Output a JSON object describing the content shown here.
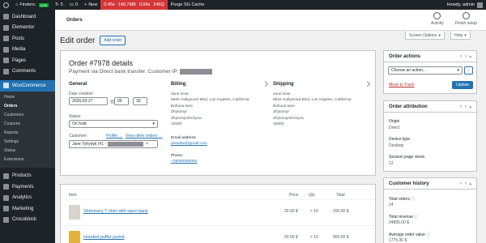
{
  "adminbar": {
    "site_name": "Findenc",
    "live_badge": "Live",
    "updates_count": "5",
    "comments_count": "0",
    "new_label": "New",
    "query_monitor": [
      "0.45s",
      "140.7MB",
      "0.06s",
      "246Q"
    ],
    "purge_label": "Purge SG Cache",
    "greeting": "Howdy, admin"
  },
  "sidebar": {
    "items_top": [
      {
        "label": "Dashboard",
        "icon": "dashboard-icon"
      },
      {
        "label": "Elementor",
        "icon": "elementor-icon"
      },
      {
        "label": "Posts",
        "icon": "pin-icon"
      },
      {
        "label": "Media",
        "icon": "media-icon"
      },
      {
        "label": "Pages",
        "icon": "pages-icon"
      },
      {
        "label": "Comments",
        "icon": "comments-icon"
      }
    ],
    "woocommerce_label": "WooCommerce",
    "submenu": [
      "Home",
      "Orders",
      "Customers",
      "Coupons",
      "Reports",
      "Settings",
      "Status",
      "Extensions"
    ],
    "items_bottom": [
      {
        "label": "Products",
        "icon": "products-icon"
      },
      {
        "label": "Payments",
        "icon": "payments-icon"
      },
      {
        "label": "Analytics",
        "icon": "analytics-icon"
      },
      {
        "label": "Marketing",
        "icon": "marketing-icon"
      },
      {
        "label": "Crocoblock",
        "icon": "crocoblock-icon"
      }
    ]
  },
  "header": {
    "title": "Orders",
    "activity_label": "Activity",
    "finish_setup_label": "Finish setup",
    "screen_options": "Screen Options",
    "help": "Help"
  },
  "page": {
    "heading": "Edit order",
    "add_order_label": "Add order"
  },
  "order": {
    "title": "Order #7978 details",
    "subtitle": "Payment via Direct bank transfer. Customer IP:",
    "general": {
      "heading": "General",
      "date_label": "Date created:",
      "date": "2026-02-27",
      "at": "@",
      "hour": "00",
      "minute": "33",
      "status_label": "Status:",
      "status": "On hold",
      "customer_label": "Customer:",
      "profile_link": "Profile →",
      "view_orders_link": "View other orders →",
      "customer_value": "Jane Tyhydyk (#1 -"
    },
    "billing": {
      "heading": "Billing",
      "address": [
        "Jane Dow",
        "6834 Hollywood Blvd, Los Angeles, California",
        "Bohuna lane",
        "Zhytomyr",
        "Zhytomyrshchyna",
        "10000"
      ],
      "email_label": "Email address:",
      "email": "janedow@gmail.com",
      "phone_label": "Phone:",
      "phone": "+38000000000"
    },
    "shipping": {
      "heading": "Shipping",
      "address": [
        "Jane Dow",
        "6834 Hollywood Blvd, Los Angeles, California",
        "Bohuna lane",
        "Zhytomyr",
        "Zhytomyrshchyna",
        "10000"
      ]
    }
  },
  "items": {
    "headers": {
      "item": "Item",
      "price": "Price",
      "qty": "Qty",
      "total": "Total"
    },
    "rows": [
      {
        "name": "Shimmery T-shirt with open back",
        "price": "20.00 $",
        "qty": "× 10",
        "total": "200.00 $"
      },
      {
        "name": "Hooded puffer jacket",
        "price": "90.00 $",
        "qty": "× 10",
        "total": "900.00 $"
      }
    ]
  },
  "order_actions": {
    "title": "Order actions",
    "select_value": "Choose an action...",
    "trash_label": "Move to Trash",
    "update_label": "Update"
  },
  "attribution": {
    "title": "Order attribution",
    "origin_label": "Origin",
    "origin": "Direct",
    "device_label": "Device type",
    "device": "Desktop",
    "views_label": "Session page views",
    "views": "12"
  },
  "customer_history": {
    "title": "Customer history",
    "total_orders_label": "Total orders",
    "total_orders": "14",
    "revenue_label": "Total revenue",
    "revenue": "24855.00 $",
    "avg_label": "Average order value",
    "avg": "1775.36 $"
  }
}
